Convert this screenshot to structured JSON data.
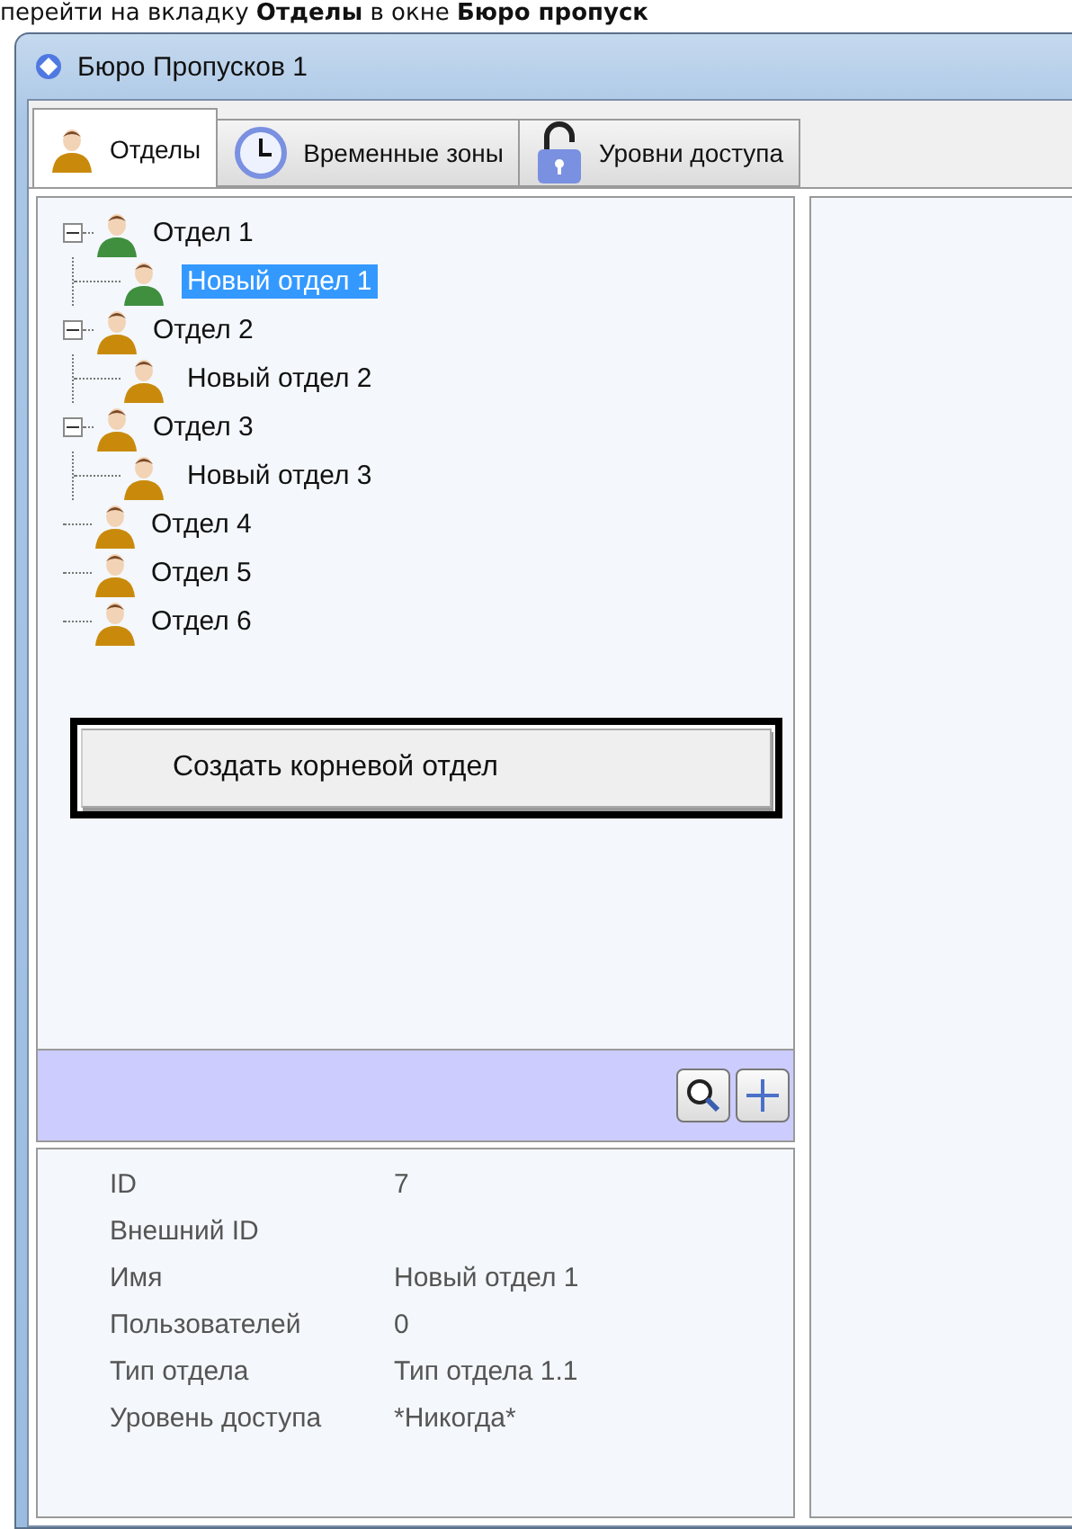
{
  "caption": "перейти на вкладку **Отделы** в окне **Бюро пропуск**",
  "window": {
    "title": "Бюро Пропусков 1"
  },
  "tabs": [
    {
      "label": "Отделы",
      "kind": "person",
      "selected": true
    },
    {
      "label": "Временные зоны",
      "kind": "clock",
      "selected": false
    },
    {
      "label": "Уровни доступа",
      "kind": "lock",
      "selected": false
    }
  ],
  "tree": [
    {
      "label": "Отдел 1",
      "color": "#3f8f3f",
      "expanded": true,
      "selected": false,
      "children": [
        {
          "label": "Новый отдел 1",
          "color": "#3f8f3f",
          "selected": true
        }
      ]
    },
    {
      "label": "Отдел 2",
      "color": "#c98a0c",
      "expanded": true,
      "selected": false,
      "children": [
        {
          "label": "Новый отдел 2",
          "color": "#c98a0c",
          "selected": false
        }
      ]
    },
    {
      "label": "Отдел 3",
      "color": "#c98a0c",
      "expanded": true,
      "selected": false,
      "children": [
        {
          "label": "Новый отдел 3",
          "color": "#c98a0c",
          "selected": false
        }
      ]
    },
    {
      "label": "Отдел 4",
      "color": "#c98a0c",
      "selected": false
    },
    {
      "label": "Отдел 5",
      "color": "#c98a0c",
      "selected": false
    },
    {
      "label": "Отдел 6",
      "color": "#c98a0c",
      "selected": false
    }
  ],
  "context_menu": {
    "items": [
      "Создать корневой отдел"
    ]
  },
  "properties": [
    {
      "label": "ID",
      "value": "7"
    },
    {
      "label": "Внешний ID"
    },
    {
      "label": "Имя",
      "value": "Новый отдел 1"
    },
    {
      "label": "Пользователей",
      "value": "0"
    },
    {
      "label": "Тип отдела",
      "value": "Тип отдела 1.1"
    },
    {
      "label": "Уровень доступа",
      "value": "*Никогда*"
    }
  ]
}
